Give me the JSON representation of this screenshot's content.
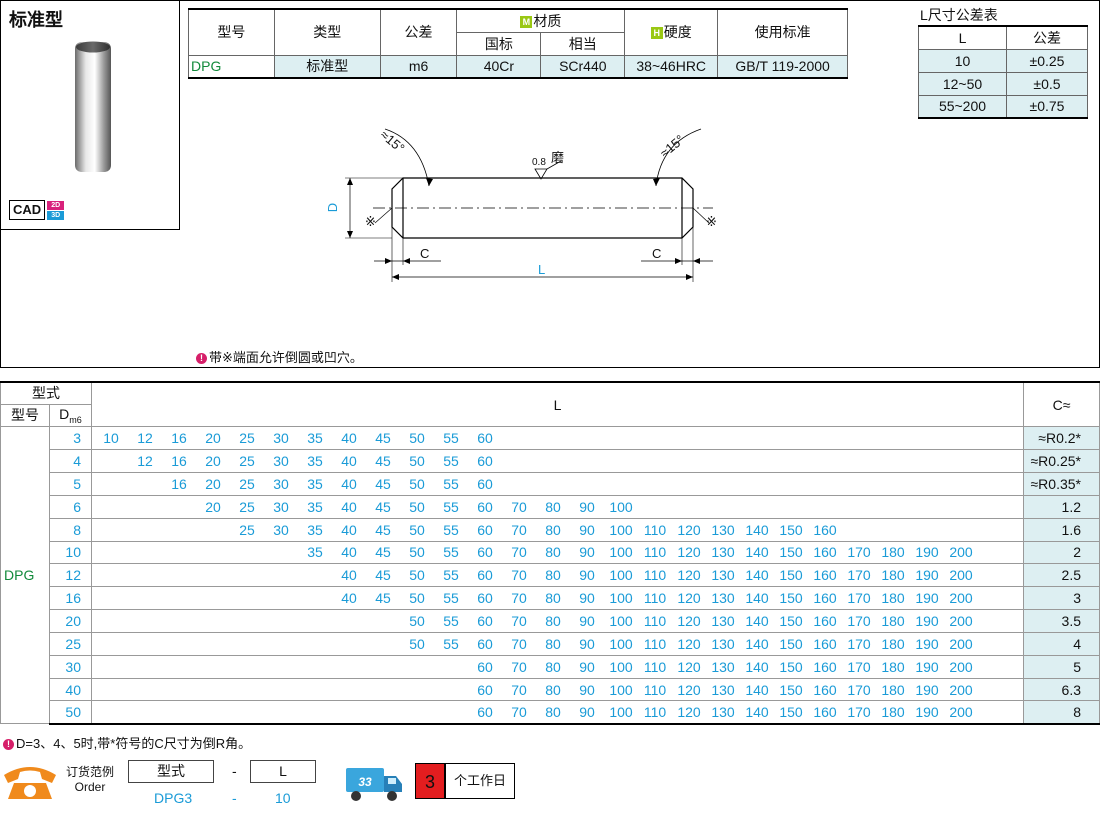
{
  "product": {
    "title": "标准型",
    "cad_label": "CAD",
    "cad_2d": "2D",
    "cad_3d": "3D"
  },
  "spec_table": {
    "headers": {
      "model": "型号",
      "type": "类型",
      "tolerance": "公差",
      "material_tag": "M",
      "material": "材质",
      "material_gb": "国标",
      "material_eq": "相当",
      "hardness_tag": "H",
      "hardness": "硬度",
      "standard": "使用标准"
    },
    "row": {
      "model": "DPG",
      "type": "标准型",
      "tolerance": "m6",
      "material_gb": "40Cr",
      "material_eq": "SCr440",
      "hardness": "38~46HRC",
      "standard": "GB/T 119-2000"
    }
  },
  "l_tolerance": {
    "title": "L尺寸公差表",
    "col_l": "L",
    "col_tol": "公差",
    "rows": [
      {
        "l": "10",
        "tol": "±0.25"
      },
      {
        "l": "12~50",
        "tol": "±0.5"
      },
      {
        "l": "55~200",
        "tol": "±0.75"
      }
    ]
  },
  "drawing": {
    "angle_left": "≈15°",
    "angle_right": "≈15°",
    "roughness": "0.8",
    "grind": "磨",
    "d_label": "D",
    "c_left": "C",
    "c_right": "C",
    "l_label": "L",
    "mark_left": "※",
    "mark_right": "※"
  },
  "note1": "带※端面允许倒圆或凹穴。",
  "size_table": {
    "hdr_form": "型式",
    "hdr_model": "型号",
    "hdr_d": "D",
    "hdr_d_sub": "m6",
    "hdr_l": "L",
    "hdr_c": "C≈",
    "model": "DPG",
    "l_columns": [
      "10",
      "12",
      "16",
      "20",
      "25",
      "30",
      "35",
      "40",
      "45",
      "50",
      "55",
      "60",
      "70",
      "80",
      "90",
      "100",
      "110",
      "120",
      "130",
      "140",
      "150",
      "160",
      "170",
      "180",
      "190",
      "200"
    ],
    "rows": [
      {
        "d": "3",
        "l": [
          "10",
          "12",
          "16",
          "20",
          "25",
          "30",
          "35",
          "40",
          "45",
          "50",
          "55",
          "60",
          "",
          "",
          "",
          "",
          "",
          "",
          "",
          "",
          "",
          "",
          "",
          "",
          "",
          ""
        ],
        "c": "≈R0.2*"
      },
      {
        "d": "4",
        "l": [
          "",
          "12",
          "16",
          "20",
          "25",
          "30",
          "35",
          "40",
          "45",
          "50",
          "55",
          "60",
          "",
          "",
          "",
          "",
          "",
          "",
          "",
          "",
          "",
          "",
          "",
          "",
          "",
          ""
        ],
        "c": "≈R0.25*"
      },
      {
        "d": "5",
        "l": [
          "",
          "",
          "16",
          "20",
          "25",
          "30",
          "35",
          "40",
          "45",
          "50",
          "55",
          "60",
          "",
          "",
          "",
          "",
          "",
          "",
          "",
          "",
          "",
          "",
          "",
          "",
          "",
          ""
        ],
        "c": "≈R0.35*"
      },
      {
        "d": "6",
        "l": [
          "",
          "",
          "",
          "20",
          "25",
          "30",
          "35",
          "40",
          "45",
          "50",
          "55",
          "60",
          "70",
          "80",
          "90",
          "100",
          "",
          "",
          "",
          "",
          "",
          "",
          "",
          "",
          "",
          ""
        ],
        "c": "1.2"
      },
      {
        "d": "8",
        "l": [
          "",
          "",
          "",
          "",
          "25",
          "30",
          "35",
          "40",
          "45",
          "50",
          "55",
          "60",
          "70",
          "80",
          "90",
          "100",
          "110",
          "120",
          "130",
          "140",
          "150",
          "160",
          "",
          "",
          "",
          ""
        ],
        "c": "1.6"
      },
      {
        "d": "10",
        "l": [
          "",
          "",
          "",
          "",
          "",
          "",
          "35",
          "40",
          "45",
          "50",
          "55",
          "60",
          "70",
          "80",
          "90",
          "100",
          "110",
          "120",
          "130",
          "140",
          "150",
          "160",
          "170",
          "180",
          "190",
          "200"
        ],
        "c": "2"
      },
      {
        "d": "12",
        "l": [
          "",
          "",
          "",
          "",
          "",
          "",
          "",
          "40",
          "45",
          "50",
          "55",
          "60",
          "70",
          "80",
          "90",
          "100",
          "110",
          "120",
          "130",
          "140",
          "150",
          "160",
          "170",
          "180",
          "190",
          "200"
        ],
        "c": "2.5"
      },
      {
        "d": "16",
        "l": [
          "",
          "",
          "",
          "",
          "",
          "",
          "",
          "40",
          "45",
          "50",
          "55",
          "60",
          "70",
          "80",
          "90",
          "100",
          "110",
          "120",
          "130",
          "140",
          "150",
          "160",
          "170",
          "180",
          "190",
          "200"
        ],
        "c": "3"
      },
      {
        "d": "20",
        "l": [
          "",
          "",
          "",
          "",
          "",
          "",
          "",
          "",
          "",
          "50",
          "55",
          "60",
          "70",
          "80",
          "90",
          "100",
          "110",
          "120",
          "130",
          "140",
          "150",
          "160",
          "170",
          "180",
          "190",
          "200"
        ],
        "c": "3.5"
      },
      {
        "d": "25",
        "l": [
          "",
          "",
          "",
          "",
          "",
          "",
          "",
          "",
          "",
          "50",
          "55",
          "60",
          "70",
          "80",
          "90",
          "100",
          "110",
          "120",
          "130",
          "140",
          "150",
          "160",
          "170",
          "180",
          "190",
          "200"
        ],
        "c": "4"
      },
      {
        "d": "30",
        "l": [
          "",
          "",
          "",
          "",
          "",
          "",
          "",
          "",
          "",
          "",
          "",
          "60",
          "70",
          "80",
          "90",
          "100",
          "110",
          "120",
          "130",
          "140",
          "150",
          "160",
          "170",
          "180",
          "190",
          "200"
        ],
        "c": "5"
      },
      {
        "d": "40",
        "l": [
          "",
          "",
          "",
          "",
          "",
          "",
          "",
          "",
          "",
          "",
          "",
          "60",
          "70",
          "80",
          "90",
          "100",
          "110",
          "120",
          "130",
          "140",
          "150",
          "160",
          "170",
          "180",
          "190",
          "200"
        ],
        "c": "6.3"
      },
      {
        "d": "50",
        "l": [
          "",
          "",
          "",
          "",
          "",
          "",
          "",
          "",
          "",
          "",
          "",
          "60",
          "70",
          "80",
          "90",
          "100",
          "110",
          "120",
          "130",
          "140",
          "150",
          "160",
          "170",
          "180",
          "190",
          "200"
        ],
        "c": "8"
      }
    ]
  },
  "note2": "D=3、4、5时,带*符号的C尺寸为倒R角。",
  "order": {
    "label_cn": "订货范例",
    "label_en": "Order",
    "form_header": "型式",
    "dash": "-",
    "l_header": "L",
    "form_value": "DPG3",
    "l_value": "10",
    "days_num": "3",
    "days_text": "个工作日"
  },
  "colors": {
    "accent_cyan": "#1a9bd7",
    "model_green": "#128a3b",
    "cell_bg": "#ddeff2",
    "warn_pink": "#d61f69",
    "days_red": "#e31d1f",
    "phone_orange": "#f08a1c"
  }
}
